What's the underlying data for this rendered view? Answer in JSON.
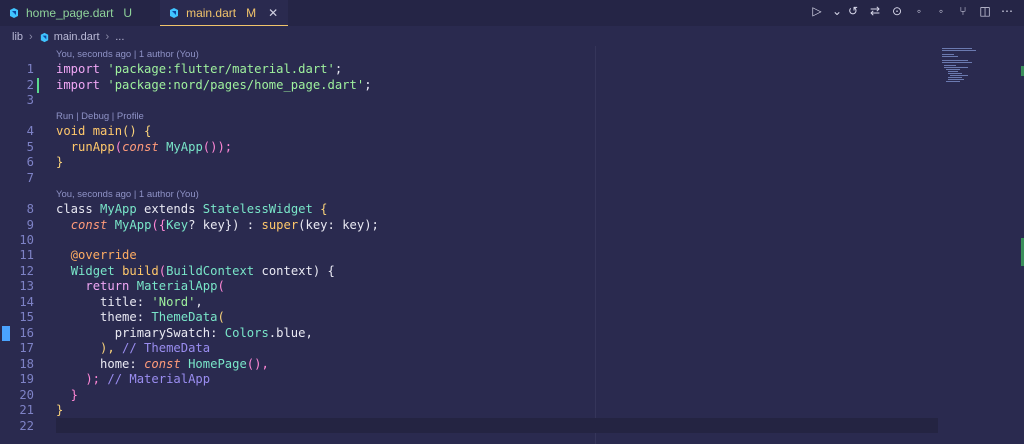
{
  "tabs": [
    {
      "label": "home_page.dart",
      "badge": "U"
    },
    {
      "label": "main.dart",
      "badge": "M",
      "close": "✕"
    }
  ],
  "breadcrumb": {
    "folder": "lib",
    "file": "main.dart",
    "more": "..."
  },
  "codelens": {
    "blame1": "You, seconds ago | 1 author (You)",
    "run": "Run | Debug | Profile",
    "blame2": "You, seconds ago | 1 author (You)"
  },
  "lines": [
    "1",
    "2",
    "3",
    "4",
    "5",
    "6",
    "7",
    "8",
    "9",
    "10",
    "11",
    "12",
    "13",
    "14",
    "15",
    "16",
    "17",
    "18",
    "19",
    "20",
    "21",
    "22"
  ],
  "code": {
    "l1a": "import ",
    "l1b": "'package:flutter/material.dart'",
    "l1c": ";",
    "l2a": "import ",
    "l2b": "'package:nord/pages/home_page.dart'",
    "l2c": ";",
    "l4a": "void ",
    "l4b": "main",
    "l4c": "() {",
    "l5a": "  ",
    "l5b": "runApp",
    "l5c": "(",
    "l5d": "const ",
    "l5e": "MyApp",
    "l5f": "());",
    "l6": "}",
    "l8a": "class ",
    "l8b": "MyApp",
    "l8c": " extends ",
    "l8d": "StatelessWidget",
    "l8e": " {",
    "l9a": "  ",
    "l9b": "const ",
    "l9c": "MyApp",
    "l9d": "({",
    "l9e": "Key",
    "l9f": "? key}) : ",
    "l9g": "super",
    "l9h": "(key: key);",
    "l11": "  @override",
    "l12a": "  ",
    "l12b": "Widget",
    "l12c": " ",
    "l12d": "build",
    "l12e": "(",
    "l12f": "BuildContext",
    "l12g": " context) {",
    "l13a": "    ",
    "l13b": "return ",
    "l13c": "MaterialApp",
    "l13d": "(",
    "l14a": "      title: ",
    "l14b": "'Nord'",
    "l14c": ",",
    "l15a": "      theme: ",
    "l15b": "ThemeData",
    "l15c": "(",
    "l16a": "        primarySwatch: ",
    "l16b": "Colors",
    "l16c": ".blue,",
    "l17a": "      ), ",
    "l17b": "// ThemeData",
    "l18a": "      home: ",
    "l18b": "const ",
    "l18c": "HomePage",
    "l18d": "(),",
    "l19a": "    ); ",
    "l19b": "// MaterialApp",
    "l20": "  }",
    "l21": "}"
  }
}
